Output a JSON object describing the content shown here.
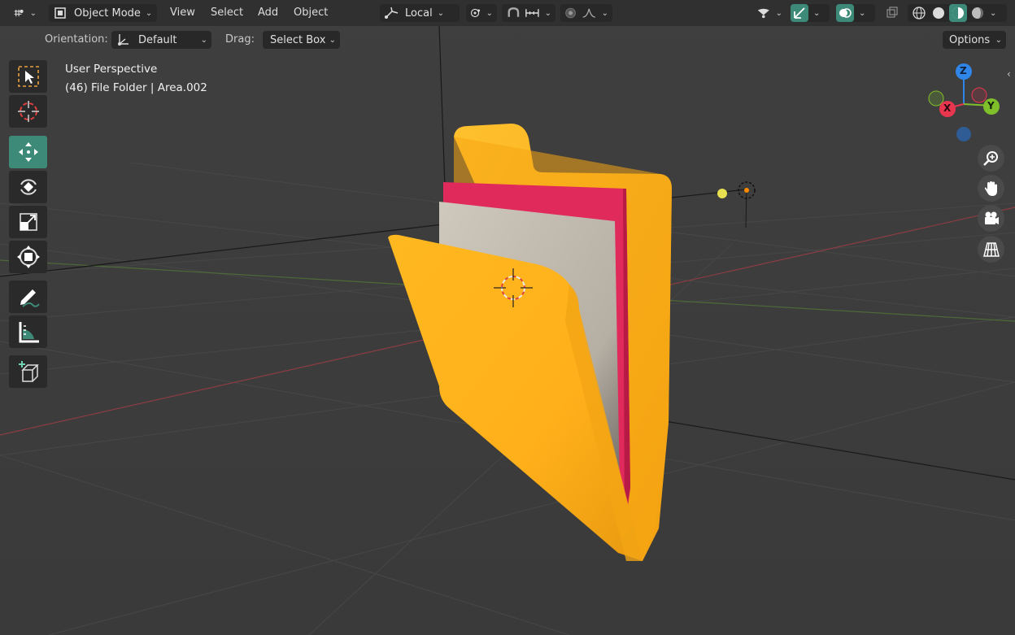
{
  "header": {
    "editor_icon": "grid-axis-icon",
    "mode_label": "Object Mode",
    "menus": [
      "View",
      "Select",
      "Add",
      "Object"
    ],
    "transform_pivot_label": "Local"
  },
  "tool_settings": {
    "orientation_label": "Orientation:",
    "orientation_value": "Default",
    "drag_label": "Drag:",
    "drag_value": "Select Box",
    "options_label": "Options"
  },
  "viewport_info": {
    "perspective": "User Perspective",
    "object_info": "(46) File Folder | Area.002"
  },
  "gizmo": {
    "z_label": "Z",
    "x_label": "X",
    "y_label": "Y"
  },
  "toolbar_tools": [
    "select-box",
    "cursor",
    "move",
    "rotate",
    "scale",
    "transform",
    "annotate",
    "measure",
    "add-cube"
  ],
  "active_tool": "move",
  "colors": {
    "accent": "#3d8a79",
    "folder_yellow": "#ffb21c",
    "paper_pink": "#e0285a",
    "paper_grey": "#c4bdb2",
    "axis_red": "#e8364f",
    "axis_green": "#7fbf2a",
    "axis_blue": "#2f86e8"
  }
}
